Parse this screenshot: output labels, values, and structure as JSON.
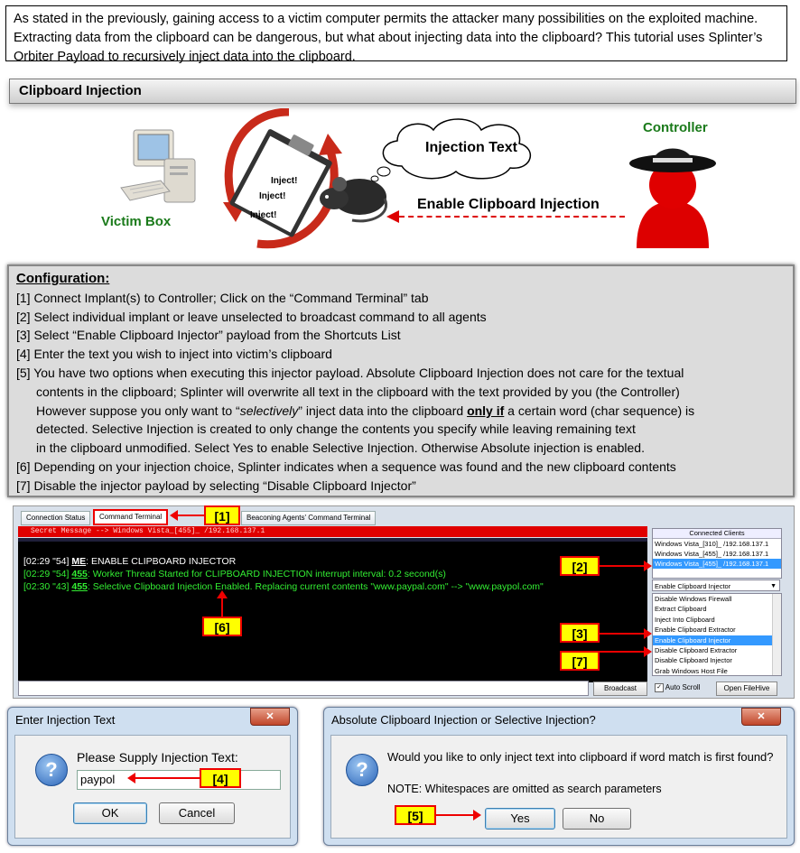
{
  "intro": "As stated in the previously, gaining access to a victim computer permits the attacker many possibilities on the exploited machine. Extracting data from the clipboard can be dangerous, but what about injecting data into the clipboard? This tutorial uses Splinter’s Orbiter Payload to recursively inject data into the clipboard.",
  "section_title": "Clipboard Injection",
  "illustration": {
    "victim_label": "Victim Box",
    "controller_label": "Controller",
    "cloud_text": "Injection Text",
    "arrow_label": "Enable Clipboard Injection",
    "inject_words": [
      "Inject!",
      "Inject!",
      "Inject!"
    ]
  },
  "config": {
    "title": "Configuration:",
    "steps": [
      {
        "lines": [
          "[1] Connect Implant(s) to Controller; Click on the “Command Terminal” tab"
        ]
      },
      {
        "lines": [
          "[2] Select individual implant or leave unselected to broadcast command to all agents"
        ]
      },
      {
        "lines": [
          "[3] Select “Enable Clipboard Injector” payload from the Shortcuts List"
        ]
      },
      {
        "lines": [
          "[4] Enter the text you wish to inject into victim’s clipboard"
        ]
      }
    ],
    "step5": {
      "a": "[5] You have two options when executing this injector payload. Absolute Clipboard Injection does not care for the textual",
      "b": "contents in the clipboard; Splinter will overwrite all text in the clipboard with the text provided by you (the Controller)",
      "c1": "However suppose you only want to “",
      "c_italic": "selectively",
      "c2": "” inject data into the clipboard ",
      "c_bold": "only if",
      "c3": " a certain word (char sequence) is",
      "d": "detected. Selective Injection is created to only change the contents you specify while leaving remaining text",
      "e": "in the clipboard unmodified.  Select Yes to enable Selective Injection. Otherwise Absolute injection is enabled."
    },
    "step6": "[6] Depending on your injection choice, Splinter indicates when a sequence was found and the new clipboard contents",
    "step7": "[7] Disable the injector payload by selecting “Disable Clipboard Injector”"
  },
  "terminal": {
    "tabs": [
      "Connection Status",
      "Command Terminal",
      "Beaconing Agents' Command Terminal"
    ],
    "secret_message": "Secret Message --> Windows Vista_[455]_ /192.168.137.1",
    "lines": [
      {
        "time": "[02:29 \"54]",
        "who": "ME",
        "text": ":  ENABLE CLIPBOARD INJECTOR",
        "color": "#ffffff"
      },
      {
        "time": "[02:29 \"54]",
        "who": "455",
        "text": ":  Worker Thread Started for CLIPBOARD INJECTION interrupt interval: 0.2 second(s)",
        "color": "#33ee33"
      },
      {
        "time": "[02:30 \"43]",
        "who": "455",
        "text": ":  Selective Clipboard Injection Enabled. Replacing current contents \"www.paypal.com\" --> \"www.paypol.com\"",
        "color": "#33ee33"
      }
    ],
    "broadcast_label": "Broadcast",
    "connected_clients_header": "Connected Clients",
    "clients": [
      "Windows Vista_[310]_ /192.168.137.1",
      "Windows Vista_[455]_ /192.168.137.1",
      "Windows Vista_[455]_ /192.168.137.1"
    ],
    "payload_selected": "Enable Clipboard Injector",
    "payloads": [
      "Disable Windows Firewall",
      "Extract Clipboard",
      "Inject Into Clipboard",
      "Enable Clipboard Extractor",
      "Enable Clipboard Injector",
      "Disable Clipboard Extractor",
      "Disable Clipboard Injector",
      "Grab Windows Host File"
    ],
    "auto_scroll_label": "Auto Scroll",
    "open_filehive_label": "Open FileHive"
  },
  "callouts": {
    "c1": "[1]",
    "c2": "[2]",
    "c3": "[3]",
    "c4": "[4]",
    "c5": "[5]",
    "c6": "[6]",
    "c7": "[7]"
  },
  "dialog1": {
    "title": "Enter Injection Text",
    "prompt": "Please Supply Injection Text:",
    "value": "paypol",
    "ok": "OK",
    "cancel": "Cancel"
  },
  "dialog2": {
    "title": "Absolute Clipboard Injection or Selective Injection?",
    "question": "Would you like to only inject text into clipboard if word match is first found?",
    "note": "NOTE: Whitespaces are omitted as search parameters",
    "yes": "Yes",
    "no": "No"
  },
  "icons": {
    "close": "✕",
    "question": "?"
  }
}
